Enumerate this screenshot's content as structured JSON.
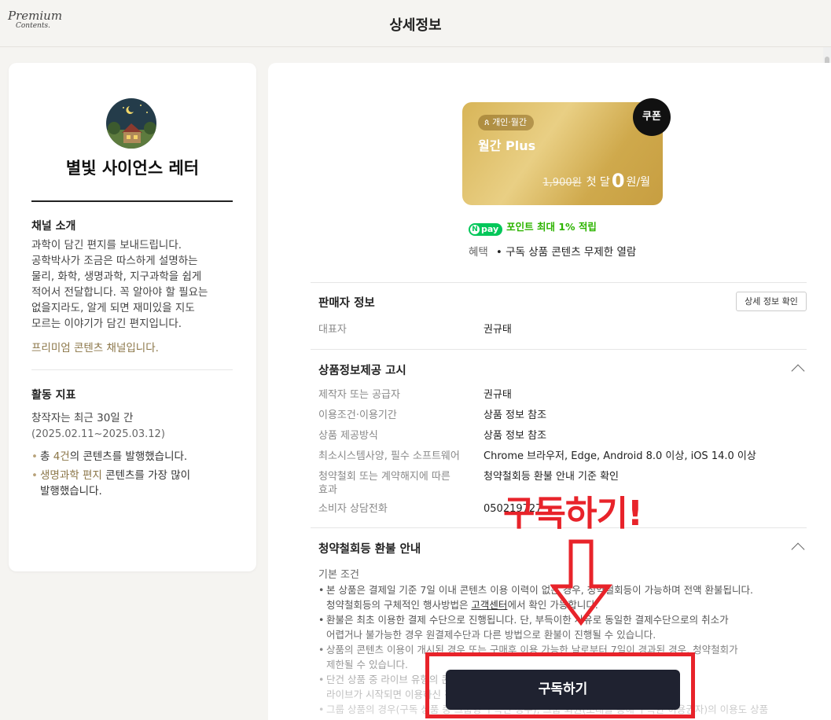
{
  "header": {
    "logo_line1": "Premium",
    "logo_line2": "Contents.",
    "title": "상세정보"
  },
  "channel": {
    "avatar_icon": "starry-night-house-avatar",
    "name": "별빛 사이언스 레터",
    "intro_title": "채널 소개",
    "intro_lines": [
      "과학이 담긴 편지를 보내드립니다.",
      "공학박사가 조금은 따스하게 설명하는",
      "물리, 화학, 생명과학, 지구과학을 쉽게",
      "적어서 전달합니다. 꼭 알아야 할 필요는",
      "없을지라도, 알게 되면 재미있을 지도",
      "모르는 이야기가 담긴 편지입니다."
    ],
    "intro_link": "프리미엄 콘텐츠 채널입니다.",
    "activity_title": "활동 지표",
    "activity_period_label": "창작자는 최근 30일 간",
    "activity_range": "(2025.02.11~2025.03.12)",
    "activity_1_prefix": "총 ",
    "activity_1_accent": "4건",
    "activity_1_suffix": "의 콘텐츠를 발행했습니다.",
    "activity_2_accent": "생명과학 편지",
    "activity_2_suffix": " 콘텐츠를 가장 많이",
    "activity_2_line2": "발행했습니다."
  },
  "plan": {
    "badge": "개인·월간",
    "title": "월간 Plus",
    "original_price": "1,900원",
    "first_month_label": "첫 달",
    "price": "0",
    "price_unit": "원/월",
    "coupon": "쿠폰",
    "npay_logo": "pay",
    "npay_text": "포인트 최대 1% 적립",
    "benefit_label": "혜택",
    "benefit_text": "• 구독 상품 콘텐츠 무제한 열람",
    "accent_color": "#d8b558"
  },
  "seller": {
    "title": "판매자 정보",
    "detail_button": "상세 정보 확인",
    "rep_label": "대표자",
    "rep_value": "권규태"
  },
  "product_notice": {
    "title": "상품정보제공 고시",
    "rows": [
      {
        "k": "제작자 또는 공급자",
        "v": "권규태"
      },
      {
        "k": "이용조건·이용기간",
        "v": "상품 정보 참조"
      },
      {
        "k": "상품 제공방식",
        "v": "상품 정보 참조"
      },
      {
        "k": "최소시스템사양, 필수 소프트웨어",
        "v": "Chrome 브라우저, Edge, Android 8.0 이상, iOS 14.0 이상"
      },
      {
        "k": "청약철회 또는 계약해지에 따른",
        "k2": "효과",
        "v": "청약철회등 환불 안내 기준 확인"
      },
      {
        "k": "소비자 상담전화",
        "v": "050219727"
      }
    ]
  },
  "refund": {
    "title": "청약철회등 환불 안내",
    "basic_label": "기본 조건",
    "line1": "본 상품은 결제일 기준 7일 이내 콘텐츠 이용 이력이 없는 경우, 청약철회등이 가능하며 전액 환불됩니다.",
    "line1b_pre": "청약철회등의 구체적인 행사방법은 ",
    "line1b_link": "고객센터",
    "line1b_post": "에서 확인 가능합니다.",
    "line2": "환불은 최초 이용한 결제 수단으로 진행됩니다. 단, 부득이한 사유로 동일한 결제수단으로의 취소가",
    "line2b": "어렵거나 불가능한 경우 원결제수단과 다른 방법으로 환불이 진행될 수 있습니다.",
    "line3": "상품의 콘텐츠 이용이 개시된 경우 또는 구매후 이용 가능한 날로부터 7일이 경과된 경우, 청약철회가",
    "line3b": "제한될 수 있습니다.",
    "line4": "단건 상품 중 라이브 유형의 콘텐츠는 라이브 시작 전까지 청약철회등 가능하며, 일단",
    "line4b": "라이브가 시작되면 이용하신 것으로 간주됩니다.",
    "line5": "그룹 상품의 경우(구독 상품 중 그룹형 구독인 경우), 그룹 회원(초대를 통해 구독한 이용권자)의 이용도 상품"
  },
  "annotation": {
    "text": "구독하기!",
    "color": "#e8232a"
  },
  "cta": {
    "label": "구독하기"
  }
}
